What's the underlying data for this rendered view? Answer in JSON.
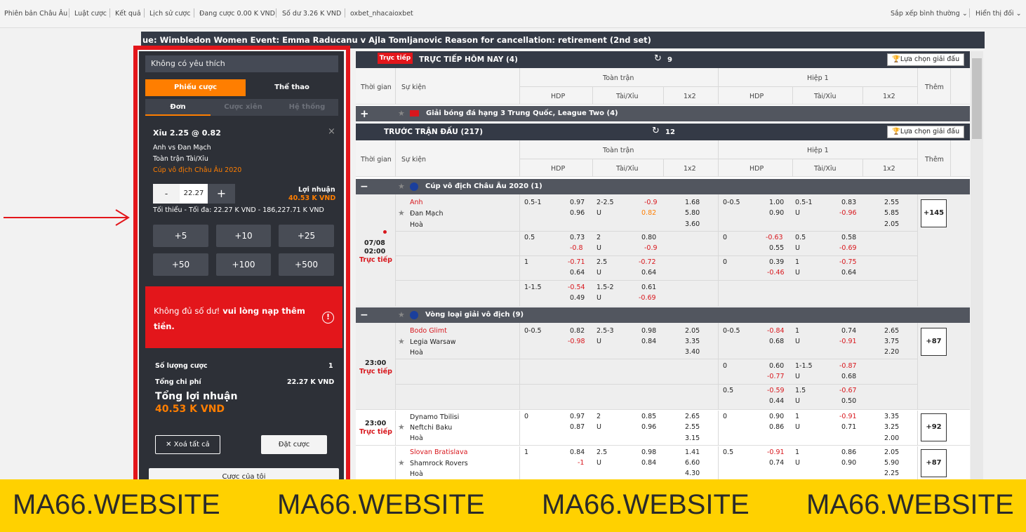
{
  "topbar": {
    "links": [
      "Phiên bản Châu Âu",
      "Luật cược",
      "Kết quả",
      "Lịch sử cược",
      "Đang cược 0.00 K VND",
      "Số dư 3.26 K VND",
      "oxbet_nhacaioxbet"
    ],
    "sort": "Sắp xếp bình thường",
    "display": "Hiển thị đối"
  },
  "ticker": "ue: Wimbledon Women Event: Emma Raducanu v Ajla Tomljanovic Reason for cancellation: retirement (2nd set)",
  "betslip": {
    "favorites": "Không có yêu thích",
    "tab_slip": "Phiếu cược",
    "tab_sport": "Thể thao",
    "subtab_single": "Đơn",
    "subtab_parlay": "Cược xiên",
    "subtab_system": "Hệ thống",
    "selection": "Xỉu 2.25 @  0.82",
    "match": "Anh vs Đan Mạch",
    "market": "Toàn trận Tài/Xỉu",
    "league": "Cúp vô địch Châu Âu 2020",
    "stake": "22.27",
    "minus": "-",
    "plus": "+",
    "profit_label": "Lợi nhuận",
    "profit_value": "40.53 K VND",
    "limits": "Tối thiểu - Tối đa: 22.27 K VND - 186,227.71 K VND",
    "quick": [
      "+5",
      "+10",
      "+25",
      "+50",
      "+100",
      "+500"
    ],
    "warning_a": "Không đủ số dư!",
    "warning_b": " vui lòng nạp thêm tiền.",
    "count_label": "Số lượng cược",
    "count_value": "1",
    "cost_label": "Tổng chi phí",
    "cost_value": "22.27 K VND",
    "total_label": "Tổng lợi nhuận",
    "total_value": "40.53 K VND",
    "clear": "Xoá tất cả",
    "place": "Đặt cược",
    "my_bets": "Cược của tôi"
  },
  "live_header": {
    "badge": "Trực tiếp",
    "title": "TRỰC TIẾP HÔM NAY (4)",
    "refresh_count": "9",
    "select": "Lựa chọn giải đấu"
  },
  "pre_header": {
    "title": "TRƯỚC TRẬN ĐẤU (217)",
    "refresh_count": "12",
    "select": "Lựa chọn giải đấu"
  },
  "columns": {
    "time": "Thời gian",
    "event": "Sự kiện",
    "full": "Toàn trận",
    "half": "Hiệp 1",
    "hdp": "HDP",
    "ou": "Tài/Xỉu",
    "x12": "1x2",
    "more": "Thêm"
  },
  "live_league": "Giải bóng đá hạng 3 Trung Quốc, League Two (4)",
  "league1": "Cúp vô địch Châu Âu 2020 (1)",
  "league2": "Vòng loại giải vô địch (9)",
  "match1": {
    "date": "07/08",
    "time": "02:00",
    "live": "Trực tiếp",
    "home": "Anh",
    "away": "Đan Mạch",
    "draw": "Hoà",
    "more": "+145"
  },
  "match2": {
    "time": "23:00",
    "live": "Trực tiếp",
    "home": "Bodo Glimt",
    "away": "Legia Warsaw",
    "draw": "Hoà",
    "more": "+87"
  },
  "match3": {
    "time": "23:00",
    "live": "Trực tiếp",
    "home": "Dynamo Tbilisi",
    "away": "Neftchi Baku",
    "draw": "Hoà",
    "more": "+92"
  },
  "match4": {
    "home": "Slovan Bratislava",
    "away": "Shamrock Rovers",
    "draw": "Hoà",
    "more": "+87"
  },
  "odds": {
    "m1r1": [
      "0.5-1",
      "0.97",
      "0.96",
      "2-2.5",
      "-0.9",
      "U",
      "0.82",
      "1.68",
      "5.80",
      "3.60",
      "0-0.5",
      "1.00",
      "0.90",
      "0.5-1",
      "0.83",
      "U",
      "-0.96",
      "2.55",
      "5.85",
      "2.05"
    ],
    "m1r2": [
      "0.5",
      "0.73",
      "-0.8",
      "2",
      "0.80",
      "U",
      "-0.9",
      "0",
      "-0.63",
      "0.55",
      "0.5",
      "0.58",
      "U",
      "-0.69"
    ],
    "m1r3": [
      "1",
      "-0.71",
      "0.64",
      "2.5",
      "-0.72",
      "U",
      "0.64",
      "0",
      "0.39",
      "-0.46",
      "1",
      "-0.75",
      "U",
      "0.64"
    ],
    "m1r4": [
      "1-1.5",
      "-0.54",
      "0.49",
      "1.5-2",
      "0.61",
      "U",
      "-0.69"
    ],
    "m2r1": [
      "0-0.5",
      "0.82",
      "-0.98",
      "2.5-3",
      "0.98",
      "U",
      "0.84",
      "2.05",
      "3.35",
      "3.40",
      "0-0.5",
      "-0.84",
      "0.68",
      "1",
      "0.74",
      "U",
      "-0.91",
      "2.65",
      "3.75",
      "2.20"
    ],
    "m2r2": [
      "0",
      "0.60",
      "-0.77",
      "1-1.5",
      "-0.87",
      "U",
      "0.68"
    ],
    "m2r3": [
      "0.5",
      "-0.59",
      "0.44",
      "1.5",
      "-0.67",
      "U",
      "0.50"
    ],
    "m3r1": [
      "0",
      "0.97",
      "0.87",
      "2",
      "0.85",
      "U",
      "0.96",
      "2.65",
      "2.55",
      "3.15",
      "0",
      "0.90",
      "0.86",
      "1",
      "-0.91",
      "U",
      "0.71",
      "3.35",
      "3.25",
      "2.00"
    ],
    "m4r1": [
      "1",
      "0.84",
      "-1",
      "2.5",
      "0.98",
      "U",
      "0.84",
      "1.41",
      "6.60",
      "4.30",
      "0.5",
      "-0.91",
      "0.74",
      "1",
      "0.86",
      "U",
      "0.90",
      "2.05",
      "5.90",
      "2.25"
    ]
  },
  "watermark": [
    "MA66.WEBSITE",
    "MA66.WEBSITE",
    "MA66.WEBSITE",
    "MA66.WEBSITE"
  ],
  "colors": {
    "accent": "#ff7e00",
    "frame": "#e3161b",
    "header": "#343a46",
    "banner": "#ffd100",
    "negative": "#d8171d"
  }
}
